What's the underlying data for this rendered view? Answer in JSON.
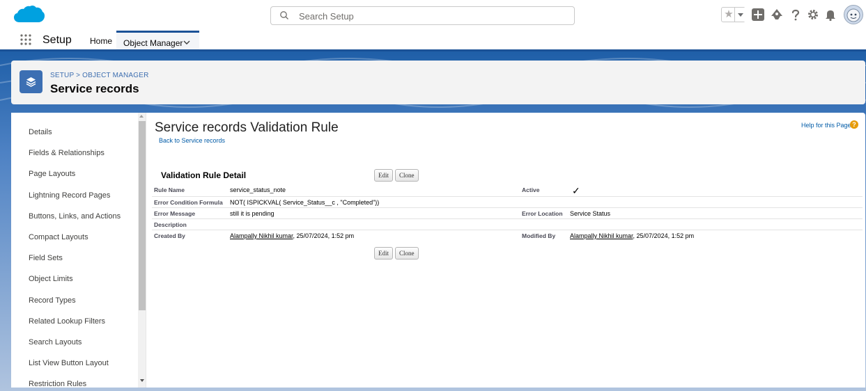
{
  "header": {
    "search_placeholder": "Search Setup",
    "icons": [
      "favorites-star-icon",
      "favorites-dropdown-icon",
      "add-icon",
      "trailhead-icon",
      "help-icon",
      "gear-icon",
      "notification-bell-icon",
      "avatar"
    ]
  },
  "context_nav": {
    "app_name": "Setup",
    "home_label": "Home",
    "object_manager_label": "Object Manager"
  },
  "page_header": {
    "breadcrumb": "SETUP > OBJECT MANAGER",
    "title": "Service records"
  },
  "sidebar": {
    "items": [
      {
        "label": "Details"
      },
      {
        "label": "Fields & Relationships"
      },
      {
        "label": "Page Layouts"
      },
      {
        "label": "Lightning Record Pages"
      },
      {
        "label": "Buttons, Links, and Actions"
      },
      {
        "label": "Compact Layouts"
      },
      {
        "label": "Field Sets"
      },
      {
        "label": "Object Limits"
      },
      {
        "label": "Record Types"
      },
      {
        "label": "Related Lookup Filters"
      },
      {
        "label": "Search Layouts"
      },
      {
        "label": "List View Button Layout"
      },
      {
        "label": "Restriction Rules"
      }
    ]
  },
  "content": {
    "title": "Service records Validation Rule",
    "back_link": "Back to Service records",
    "help_link": "Help for this Page",
    "help_icon_text": "?",
    "section_title": "Validation Rule Detail",
    "edit_label": "Edit",
    "clone_label": "Clone",
    "rule_name_label": "Rule Name",
    "rule_name": "service_status_note",
    "active_label": "Active",
    "active_check": "✓",
    "formula_label": "Error Condition Formula",
    "formula": "NOT( ISPICKVAL( Service_Status__c , \"Completed\"))",
    "error_message_label": "Error Message",
    "error_message": "still it is pending",
    "error_location_label": "Error Location",
    "error_location": "Service Status",
    "description_label": "Description",
    "created_by_label": "Created By",
    "created_by_user": "Alampally Nikhil kumar",
    "created_by_date": ", 25/07/2024, 1:52 pm",
    "modified_by_label": "Modified By",
    "modified_by_user": "Alampally Nikhil kumar",
    "modified_by_date": ", 25/07/2024, 1:52 pm"
  },
  "colors": {
    "brand_blue": "#1b5297",
    "link_blue": "#015ba7",
    "logo_blue": "#00a1e0"
  }
}
